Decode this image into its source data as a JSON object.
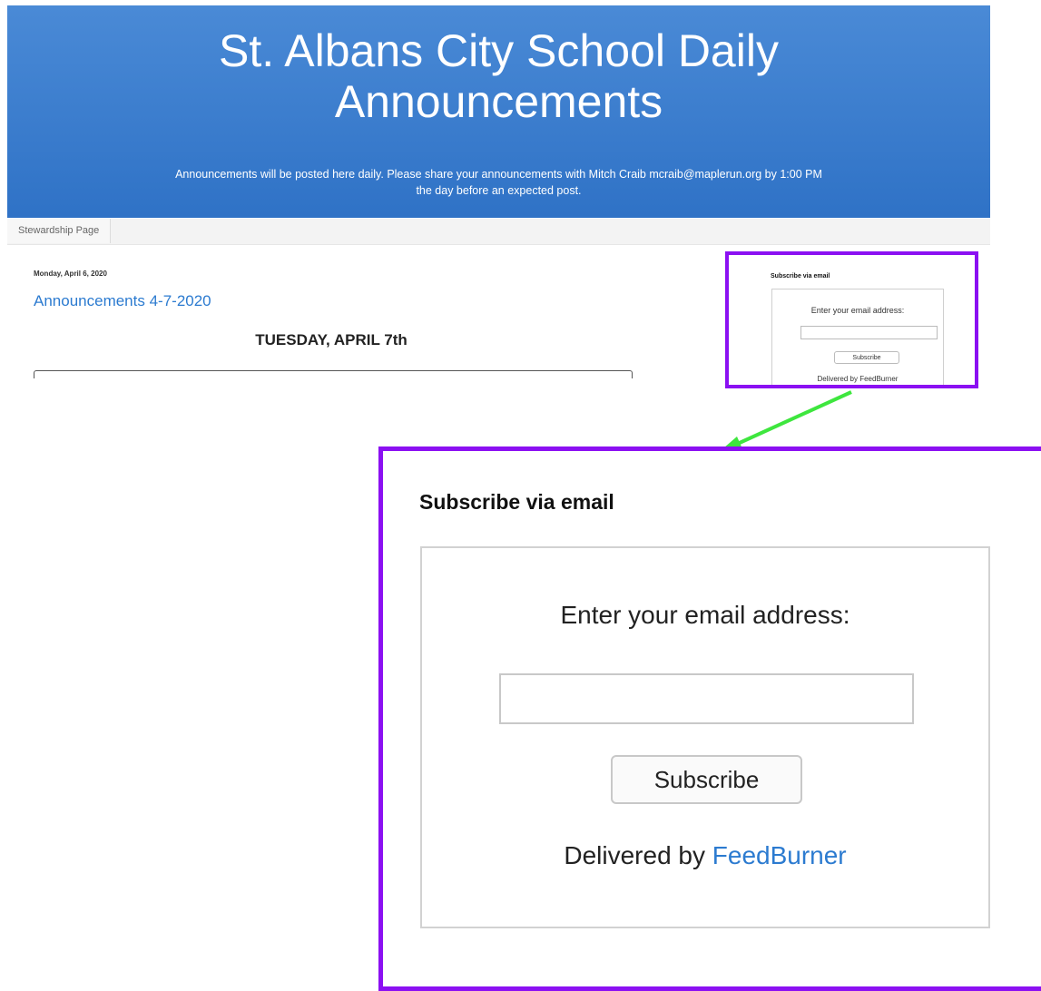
{
  "header": {
    "title_line1": "St. Albans City School Daily",
    "title_line2": "Announcements",
    "description_line1": "Announcements will be posted here daily. Please share your announcements with Mitch Craib mcraib@maplerun.org by 1:00 PM",
    "description_line2": "the day before an expected post."
  },
  "tabs": [
    "Stewardship Page"
  ],
  "post": {
    "date": "Monday, April 6, 2020",
    "title": "Announcements 4-7-2020",
    "heading": "TUESDAY, APRIL 7th"
  },
  "subscribe_widget": {
    "title": "Subscribe via email",
    "label": "Enter your email address:",
    "input_value": "",
    "button_label": "Subscribe",
    "delivered_prefix": "Delivered by ",
    "delivered_link": "FeedBurner",
    "small_delivered_text": "Delivered by FeedBurner"
  },
  "colors": {
    "header_blue": "#3b7fd0",
    "highlight_purple": "#8b10f2",
    "arrow_green": "#3ee63e",
    "link_blue": "#2c7bd0"
  }
}
